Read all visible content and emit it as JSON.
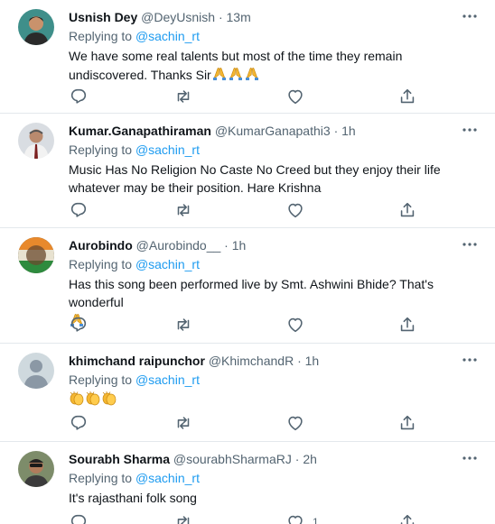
{
  "replying_prefix": "Replying to",
  "tweets": [
    {
      "name": "Usnish Dey",
      "handle": "@DeyUsnish",
      "sep": "·",
      "time": "13m",
      "reply_to": "@sachin_rt",
      "text": "We have some real talents but most of the time they remain undiscovered. Thanks Sir",
      "emoji": "folded-hands-x3",
      "like_count": ""
    },
    {
      "name": "Kumar.Ganapathiraman",
      "handle": "@KumarGanapathi3",
      "sep": "·",
      "time": "1h",
      "reply_to": "@sachin_rt",
      "text": "Music Has No Religion No Caste No Creed but they enjoy their life whatever may be their position. Hare Krishna",
      "like_count": ""
    },
    {
      "name": "Aurobindo",
      "handle": "@Aurobindo__",
      "sep": "·",
      "time": "1h",
      "reply_to": "@sachin_rt",
      "text": "Has this song been performed live by Smt. Ashwini Bhide? That's wonderful",
      "emoji": "folded-hands",
      "like_count": ""
    },
    {
      "name": "khimchand raipunchor",
      "handle": "@KhimchandR",
      "sep": "·",
      "time": "1h",
      "reply_to": "@sachin_rt",
      "text": "",
      "emoji": "clapping-hands-x3",
      "like_count": ""
    },
    {
      "name": "Sourabh Sharma",
      "handle": "@sourabhSharmaRJ",
      "sep": "·",
      "time": "2h",
      "reply_to": "@sachin_rt",
      "text": "It's rajasthani folk song",
      "like_count": "1"
    }
  ]
}
